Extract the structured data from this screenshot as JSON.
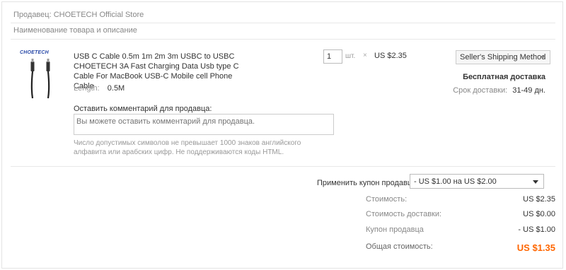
{
  "seller": {
    "label": "Продавец:",
    "name": "CHOETECH Official Store"
  },
  "section_title": "Наименование товара и описание",
  "product": {
    "brand_logo": "CHOETECH",
    "title": "USB C Cable 0.5m 1m 2m 3m USBC to USBC CHOETECH 3A Fast Charging Data Usb type C Cable For MacBook USB-C Mobile cell Phone Cable",
    "property_name": "Length:",
    "property_value": "0.5M",
    "quantity": "1",
    "quantity_unit": "шт.",
    "times_sign": "×",
    "unit_price": "US $2.35"
  },
  "comment": {
    "label": "Оставить комментарий для продавца:",
    "placeholder": "Вы можете оставить комментарий для продавца.",
    "hint": "Число допустимых символов не превышает 1000 знаков английского алфавита или арабских цифр. Не поддерживаются коды HTML."
  },
  "shipping": {
    "method": "Seller's Shipping Method",
    "free_label": "Бесплатная доставка",
    "delivery_label": "Срок доставки:",
    "delivery_value": "31-49 дн."
  },
  "coupon": {
    "label": "Применить купон продавца",
    "selected": "- US $1.00 на US $2.00"
  },
  "summary": {
    "cost_label": "Стоимость:",
    "cost_value": "US $2.35",
    "shipping_label": "Стоимость доставки:",
    "shipping_value": "US $0.00",
    "coupon_label": "Купон продавца",
    "coupon_value": "- US $1.00",
    "total_label": "Общая стоимость:",
    "total_value": "US $1.35"
  },
  "colors": {
    "accent": "#ff6600",
    "border": "#e4e4e4"
  }
}
